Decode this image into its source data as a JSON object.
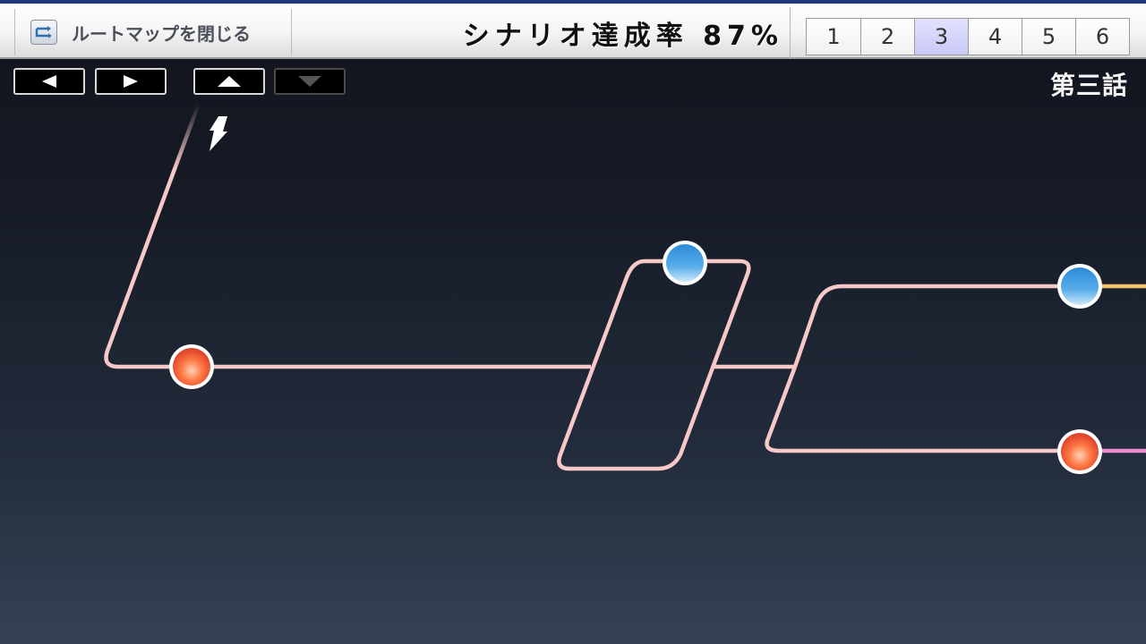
{
  "toolbar": {
    "close_label": "ルートマップを閉じる",
    "completion_text": "シナリオ達成率 87%",
    "chapters": [
      {
        "label": "1",
        "active": false
      },
      {
        "label": "2",
        "active": false
      },
      {
        "label": "3",
        "active": true
      },
      {
        "label": "4",
        "active": false
      },
      {
        "label": "5",
        "active": false
      },
      {
        "label": "6",
        "active": false
      }
    ]
  },
  "nav": {
    "left_icon": "triangle-left-icon",
    "right_icon": "triangle-right-icon",
    "up_icon": "triangle-up-icon",
    "down_icon": "triangle-down-icon",
    "down_disabled": true
  },
  "map": {
    "episode_label": "第三話",
    "route_color": "#f6c8c8",
    "branch_colors": {
      "upper_exit": "#f3c26a",
      "lower_exit": "#e98cc8"
    },
    "nodes": [
      {
        "id": "node-1",
        "kind": "orange-node"
      },
      {
        "id": "node-2",
        "kind": "blue-node"
      },
      {
        "id": "node-3",
        "kind": "blue-node"
      },
      {
        "id": "node-4",
        "kind": "orange-node"
      }
    ]
  }
}
